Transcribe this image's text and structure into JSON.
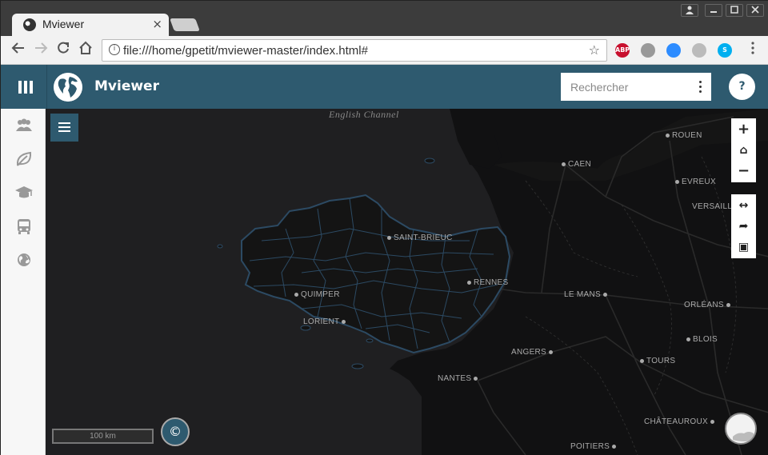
{
  "browser": {
    "tab_title": "Mviewer",
    "tab_close": "×",
    "url": "file:///home/gpetit/mviewer-master/index.html#",
    "extensions": [
      {
        "name": "adblock-plus-icon",
        "label": "ABP",
        "color": "#c8102e"
      },
      {
        "name": "feather-icon",
        "label": "",
        "color": "#999999"
      },
      {
        "name": "video-icon",
        "label": "",
        "color": "#2d8cff"
      },
      {
        "name": "cast-icon",
        "label": "",
        "color": "#bbbbbb"
      },
      {
        "name": "skype-icon",
        "label": "S",
        "color": "#00aff0"
      }
    ]
  },
  "header": {
    "title": "Mviewer",
    "search_placeholder": "Rechercher",
    "help_label": "?",
    "brand_color": "#2e5a6f"
  },
  "sidebar": {
    "items": [
      {
        "icon": "people-icon"
      },
      {
        "icon": "leaf-icon"
      },
      {
        "icon": "graduation-cap-icon"
      },
      {
        "icon": "bus-icon"
      },
      {
        "icon": "globe-icon"
      }
    ]
  },
  "map": {
    "sea_label": "English Channel",
    "scale_label": "100 km",
    "attribution_label": "©",
    "cities": [
      {
        "name": "ROUEN"
      },
      {
        "name": "CAEN"
      },
      {
        "name": "EVREUX"
      },
      {
        "name": "VERSAILL"
      },
      {
        "name": "SAINT-BRIEUC"
      },
      {
        "name": "RENNES"
      },
      {
        "name": "LE MANS"
      },
      {
        "name": "ORLÉANS"
      },
      {
        "name": "QUIMPER"
      },
      {
        "name": "LORIENT"
      },
      {
        "name": "BLOIS"
      },
      {
        "name": "ANGERS"
      },
      {
        "name": "TOURS"
      },
      {
        "name": "NANTES"
      },
      {
        "name": "CHÂTEAUROUX"
      },
      {
        "name": "POITIERS"
      }
    ],
    "zoom_controls": [
      {
        "name": "zoom-in-button",
        "label": "+"
      },
      {
        "name": "home-extent-button",
        "label": "⌂"
      },
      {
        "name": "zoom-out-button",
        "label": "−"
      }
    ],
    "tool_controls": [
      {
        "name": "measure-tool-button",
        "label": "↔"
      },
      {
        "name": "share-button",
        "label": "➦"
      },
      {
        "name": "export-image-button",
        "label": "▣"
      }
    ]
  }
}
